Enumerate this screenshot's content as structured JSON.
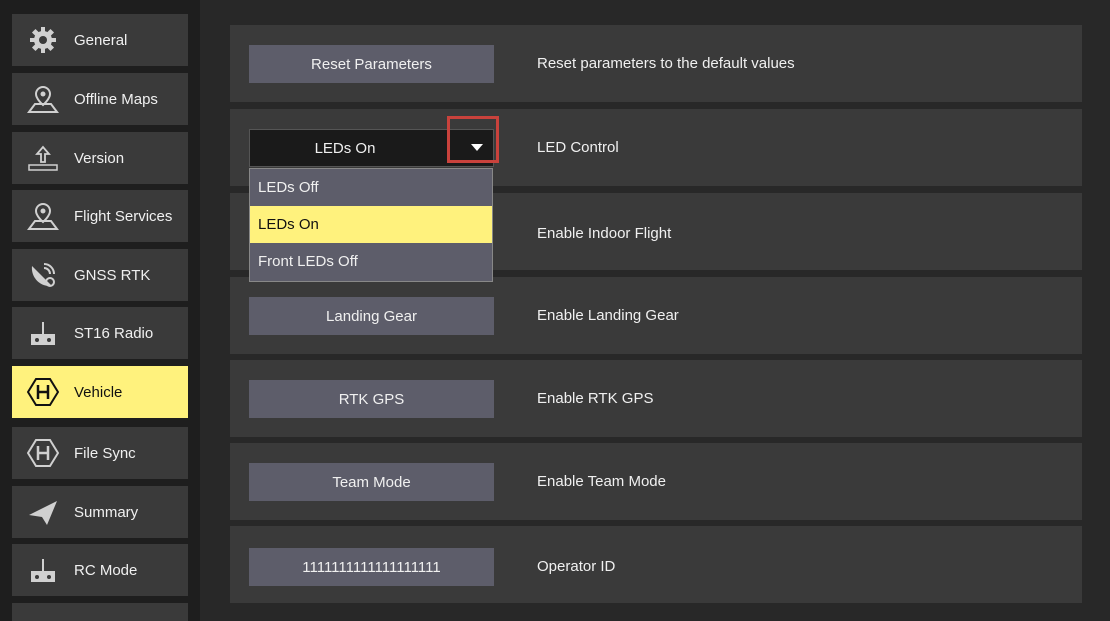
{
  "sidebar": {
    "items": [
      {
        "label": "General",
        "icon": "gear-icon"
      },
      {
        "label": "Offline Maps",
        "icon": "map-pin-icon"
      },
      {
        "label": "Version",
        "icon": "upload-icon"
      },
      {
        "label": "Flight Services",
        "icon": "map-pin-icon"
      },
      {
        "label": "GNSS RTK",
        "icon": "satellite-icon"
      },
      {
        "label": "ST16 Radio",
        "icon": "radio-controller-icon"
      },
      {
        "label": "Vehicle",
        "icon": "hexagon-h-icon",
        "active": true
      },
      {
        "label": "File Sync",
        "icon": "hexagon-h-icon"
      },
      {
        "label": "Summary",
        "icon": "paper-plane-icon"
      },
      {
        "label": "RC Mode",
        "icon": "radio-controller-icon"
      }
    ]
  },
  "rows": {
    "reset": {
      "button": "Reset Parameters",
      "desc": "Reset parameters to the default values"
    },
    "led": {
      "value": "LEDs On",
      "desc": "LED Control"
    },
    "indoor": {
      "desc": "Enable Indoor Flight"
    },
    "landing": {
      "button": "Landing Gear",
      "desc": "Enable Landing Gear"
    },
    "rtk": {
      "button": "RTK GPS",
      "desc": "Enable RTK GPS"
    },
    "team": {
      "button": "Team Mode",
      "desc": "Enable Team Mode"
    },
    "operator": {
      "button": "1111111111111111111",
      "desc": "Operator ID"
    }
  },
  "dropdown": {
    "options": [
      "LEDs Off",
      "LEDs On",
      "Front LEDs Off"
    ],
    "selected": "LEDs On"
  },
  "colors": {
    "accent": "#fff27d",
    "highlight": "#c9423c"
  }
}
